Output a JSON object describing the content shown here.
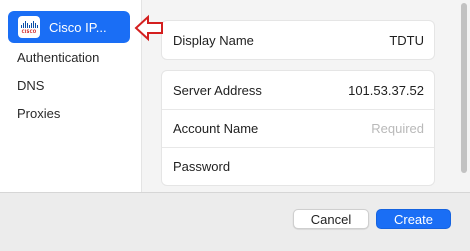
{
  "sidebar": {
    "items": [
      {
        "label": "Cisco IP...",
        "icon": "cisco-logo-icon",
        "selected": true
      },
      {
        "label": "Authentication",
        "selected": false
      },
      {
        "label": "DNS",
        "selected": false
      },
      {
        "label": "Proxies",
        "selected": false
      }
    ]
  },
  "content": {
    "display_name": {
      "label": "Display Name",
      "value": "TDTU"
    },
    "server_address": {
      "label": "Server Address",
      "value": "101.53.37.52"
    },
    "account_name": {
      "label": "Account Name",
      "value": "",
      "placeholder": "Required"
    },
    "password": {
      "label": "Password",
      "value": ""
    }
  },
  "footer": {
    "cancel_label": "Cancel",
    "create_label": "Create"
  },
  "colors": {
    "accent": "#1a6ef5",
    "annotation_arrow": "#d41f1f",
    "content_background": "#f4f4f4",
    "footer_background": "#ececec"
  }
}
